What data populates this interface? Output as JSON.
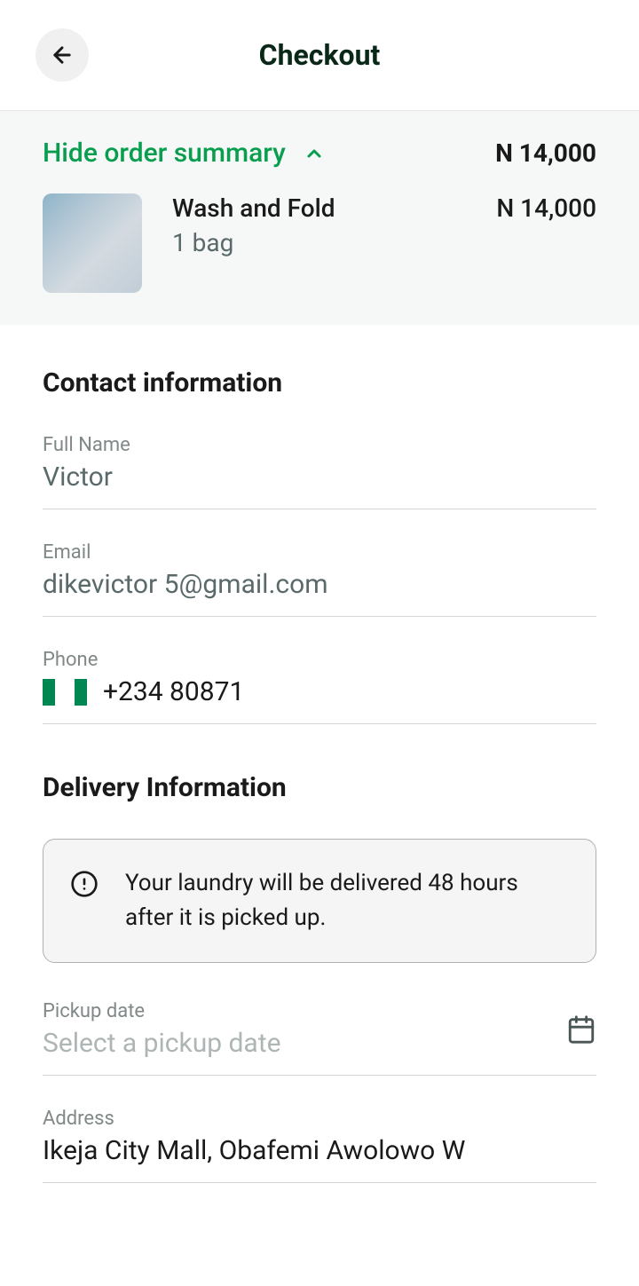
{
  "header": {
    "title": "Checkout"
  },
  "summary": {
    "toggle_label": "Hide order summary",
    "total": "N 14,000",
    "items": [
      {
        "name": "Wash and Fold",
        "qty": "1 bag",
        "price": "N 14,000"
      }
    ]
  },
  "contact": {
    "section_title": "Contact information",
    "name_label": "Full Name",
    "name_value": "Victor",
    "email_label": "Email",
    "email_value": "dikevictor             5@gmail.com",
    "phone_label": "Phone",
    "phone_value": "+234 80871"
  },
  "delivery": {
    "section_title": "Delivery Information",
    "notice": "Your laundry will be delivered 48 hours after it is picked up.",
    "pickup_label": "Pickup date",
    "pickup_placeholder": "Select a pickup date",
    "address_label": "Address",
    "address_value": "Ikeja City Mall, Obafemi Awolowo W"
  }
}
